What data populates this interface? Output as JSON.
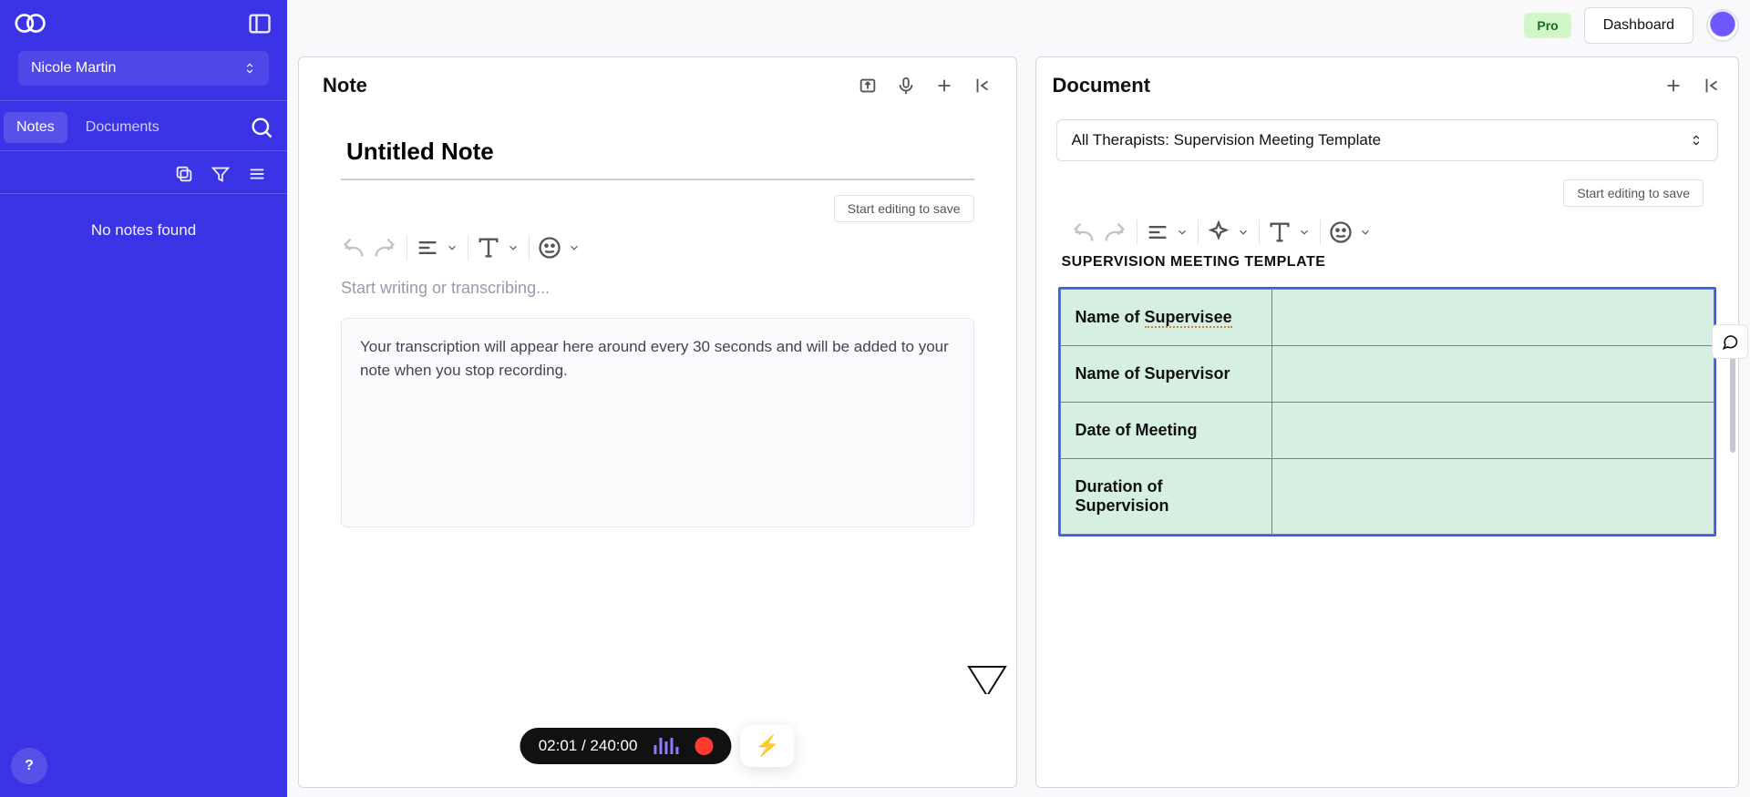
{
  "sidebar": {
    "user_name": "Nicole Martin",
    "tabs": {
      "notes": "Notes",
      "documents": "Documents"
    },
    "empty_message": "No notes found"
  },
  "topbar": {
    "pro_label": "Pro",
    "dashboard_label": "Dashboard"
  },
  "note_panel": {
    "title": "Note",
    "note_title_value": "Untitled Note",
    "status": "Start editing to save",
    "body_placeholder": "Start writing or transcribing...",
    "transcription_hint": "Your transcription will appear here around every 30 seconds and will be added to your note when you stop recording."
  },
  "document_panel": {
    "title": "Document",
    "template_selected": "All Therapists: Supervision Meeting Template",
    "status": "Start editing to save",
    "heading": "SUPERVISION MEETING TEMPLATE",
    "rows": [
      {
        "label_a": "Name of ",
        "label_b": "Supervisee",
        "value": ""
      },
      {
        "label": "Name of Supervisor",
        "value": ""
      },
      {
        "label": "Date of Meeting",
        "value": ""
      },
      {
        "label": "Duration of Supervision",
        "value": ""
      }
    ]
  },
  "recorder": {
    "elapsed": "02:01",
    "total": "240:00",
    "separator": " / "
  },
  "colors": {
    "brand": "#3b33e6",
    "table_bg": "#d5efe3"
  }
}
